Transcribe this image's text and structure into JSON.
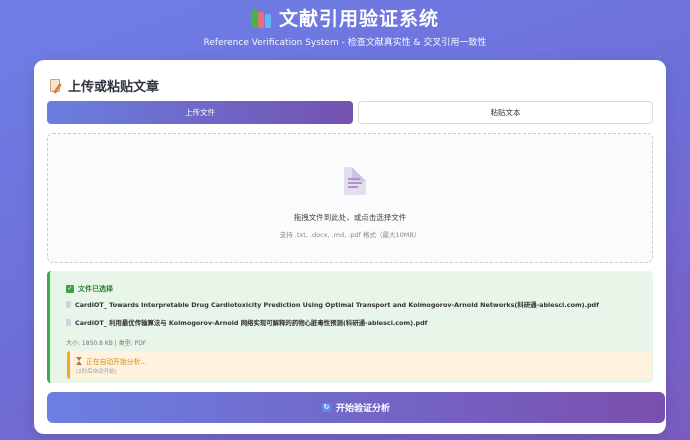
{
  "header": {
    "title": "文献引用验证系统",
    "subtitle": "Reference Verification System - 检查文献真实性 & 交叉引用一致性",
    "icon": "books-icon"
  },
  "card": {
    "heading": "上传或粘贴文章",
    "heading_icon": "memo-icon",
    "tabs": [
      {
        "label": "上传文件",
        "active": true
      },
      {
        "label": "粘贴文本",
        "active": false
      }
    ]
  },
  "dropzone": {
    "icon": "document-icon",
    "text": "拖拽文件到此处，或点击选择文件",
    "hint": "支持 .txt, .docx, .md, .pdf 格式（最大10MB）"
  },
  "selected": {
    "title": "文件已选择",
    "files": [
      "CardiOT_ Towards Interpretable Drug Cardiotoxicity Prediction Using Optimal Transport and Kolmogorov-Arnold Networks(科研通-ablesci.com).pdf",
      "CardiOT_ 利用最优传输算法与 Kolmogorov-Arnold 网络实现可解释的药物心脏毒性预测(科研通-ablesci.com).pdf"
    ],
    "meta": "大小: 1850.8 KB | 类型: PDF",
    "status": {
      "main": "正在自动开始分析...",
      "sub": "(2秒后自动开始)"
    }
  },
  "action": {
    "start_label": "开始验证分析",
    "start_icon": "refresh-icon"
  },
  "colors": {
    "accent_start": "#6b80e2",
    "accent_end": "#7a4fae",
    "success": "#3cab4f",
    "warning": "#f5a623"
  }
}
